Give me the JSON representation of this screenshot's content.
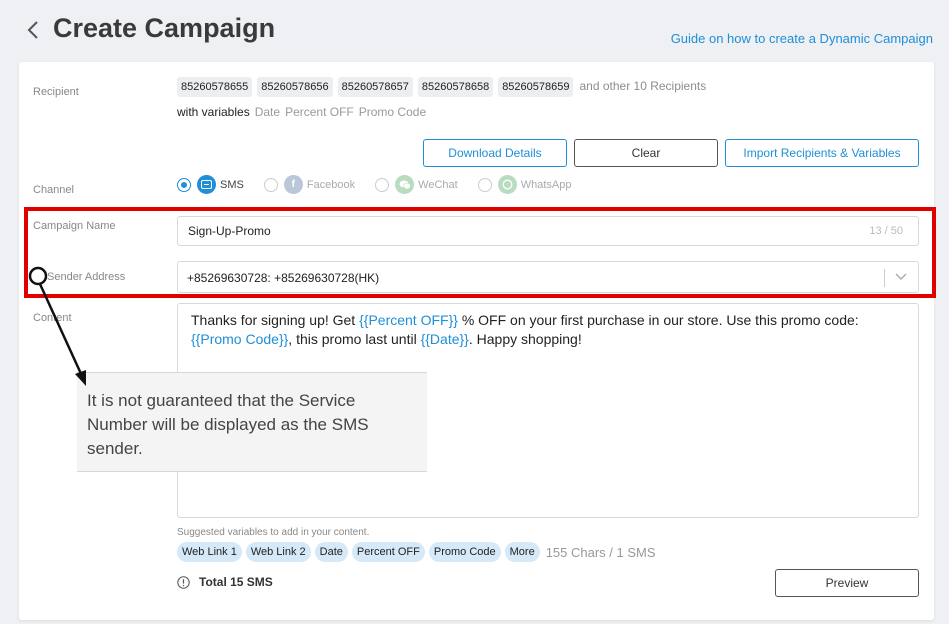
{
  "header": {
    "title": "Create Campaign",
    "guide_link": "Guide on how to create a Dynamic Campaign"
  },
  "recipient": {
    "label": "Recipient",
    "numbers": [
      "85260578655",
      "85260578656",
      "85260578657",
      "85260578658",
      "85260578659"
    ],
    "others": "and other 10 Recipients",
    "variables_label": "with variables",
    "variables": [
      "Date",
      "Percent OFF",
      "Promo Code"
    ]
  },
  "actions": {
    "download": "Download Details",
    "clear": "Clear",
    "import": "Import Recipients & Variables"
  },
  "channel": {
    "label": "Channel",
    "options": [
      {
        "name": "SMS",
        "selected": true,
        "icon": "sms-icon"
      },
      {
        "name": "Facebook",
        "selected": false,
        "icon": "facebook-icon"
      },
      {
        "name": "WeChat",
        "selected": false,
        "icon": "wechat-icon"
      },
      {
        "name": "WhatsApp",
        "selected": false,
        "icon": "whatsapp-icon"
      }
    ]
  },
  "campaign_name": {
    "label": "Campaign Name",
    "value": "Sign-Up-Promo",
    "counter": "13 / 50"
  },
  "sender": {
    "label": "Sender Address",
    "value": "+85269630728: +85269630728(HK)"
  },
  "content": {
    "label": "Content",
    "parts": [
      "Thanks for signing up! Get ",
      "{{Percent OFF}}",
      " % OFF on your first purchase in our store. Use this promo code: ",
      "{{Promo Code}}",
      ", this promo last until ",
      "{{Date}}",
      ". Happy shopping!"
    ]
  },
  "tooltip": {
    "text": "It is not guaranteed that the Service Number will be displayed as the SMS sender."
  },
  "suggestions": {
    "label": "Suggested variables to add in your content.",
    "items": [
      "Web Link 1",
      "Web Link 2",
      "Date",
      "Percent OFF",
      "Promo Code",
      "More"
    ],
    "char_count": "155 Chars / 1 SMS"
  },
  "footer": {
    "total": "Total 15 SMS",
    "preview": "Preview"
  },
  "colors": {
    "accent": "#1f8fd6",
    "highlight": "#e00000"
  }
}
